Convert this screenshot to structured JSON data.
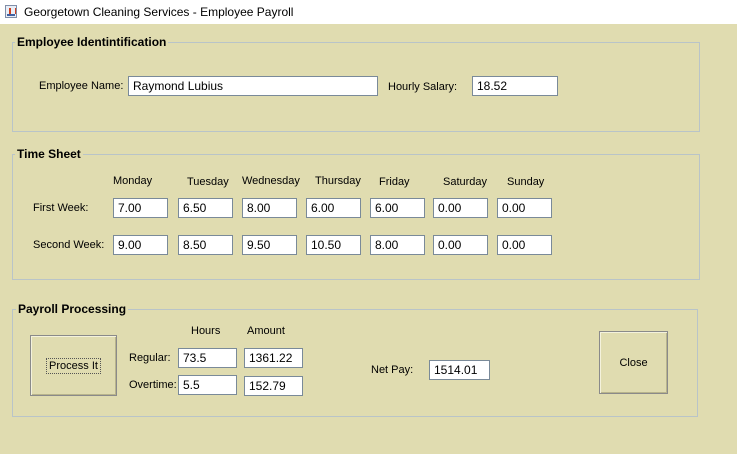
{
  "window": {
    "title": "Georgetown Cleaning Services - Employee Payroll",
    "icon": "java-icon"
  },
  "employee_identification": {
    "title": "Employee Identintification",
    "name_label": "Employee Name:",
    "name_value": "Raymond Lubius",
    "salary_label": "Hourly Salary:",
    "salary_value": "18.52"
  },
  "time_sheet": {
    "title": "Time Sheet",
    "days": [
      "Monday",
      "Tuesday",
      "Wednesday",
      "Thursday",
      "Friday",
      "Saturday",
      "Sunday"
    ],
    "weeks": [
      {
        "label": "First Week:",
        "values": [
          "7.00",
          "6.50",
          "8.00",
          "6.00",
          "6.00",
          "0.00",
          "0.00"
        ]
      },
      {
        "label": "Second Week:",
        "values": [
          "9.00",
          "8.50",
          "9.50",
          "10.50",
          "8.00",
          "0.00",
          "0.00"
        ]
      }
    ]
  },
  "payroll_processing": {
    "title": "Payroll Processing",
    "process_button": "Process It",
    "hours_header": "Hours",
    "amount_header": "Amount",
    "regular_label": "Regular:",
    "regular_hours": "73.5",
    "regular_amount": "1361.22",
    "overtime_label": "Overtime:",
    "overtime_hours": "5.5",
    "overtime_amount": "152.79",
    "net_pay_label": "Net Pay:",
    "net_pay_value": "1514.01",
    "close_button": "Close"
  }
}
